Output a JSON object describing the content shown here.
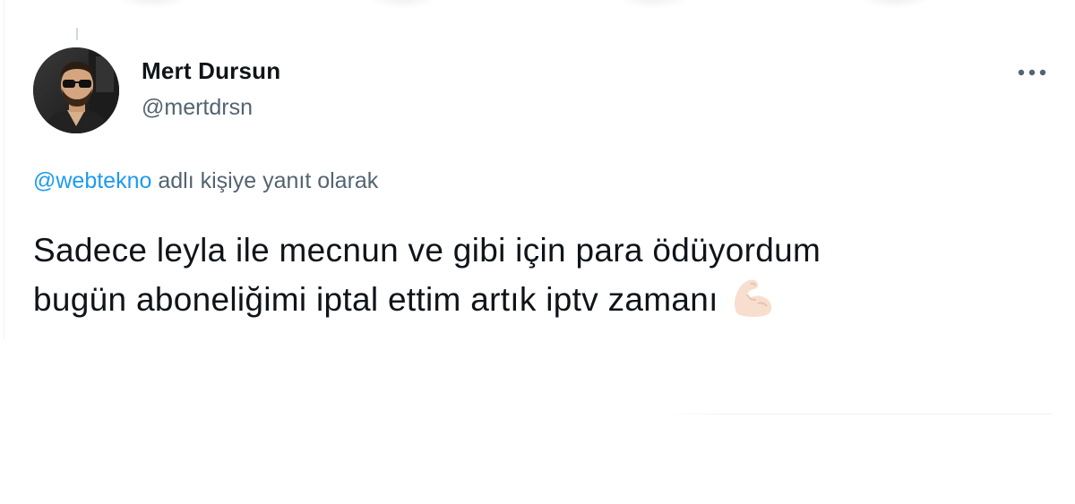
{
  "tweet": {
    "author": {
      "display_name": "Mert Dursun",
      "handle": "@mertdrsn"
    },
    "reply_context": {
      "mention": "@webtekno",
      "text": "adlı kişiye yanıt olarak"
    },
    "text_lines": [
      "Sadece leyla ile mecnun ve gibi için para ödüyordum",
      "bugün aboneliğimi iptal ettim artık iptv zamanı"
    ],
    "emoji": "flexed-biceps-icon",
    "menu_icon": "more-horizontal-icon"
  },
  "colors": {
    "text": "#0f1419",
    "secondary": "#536471",
    "link": "#1d9bf0"
  }
}
